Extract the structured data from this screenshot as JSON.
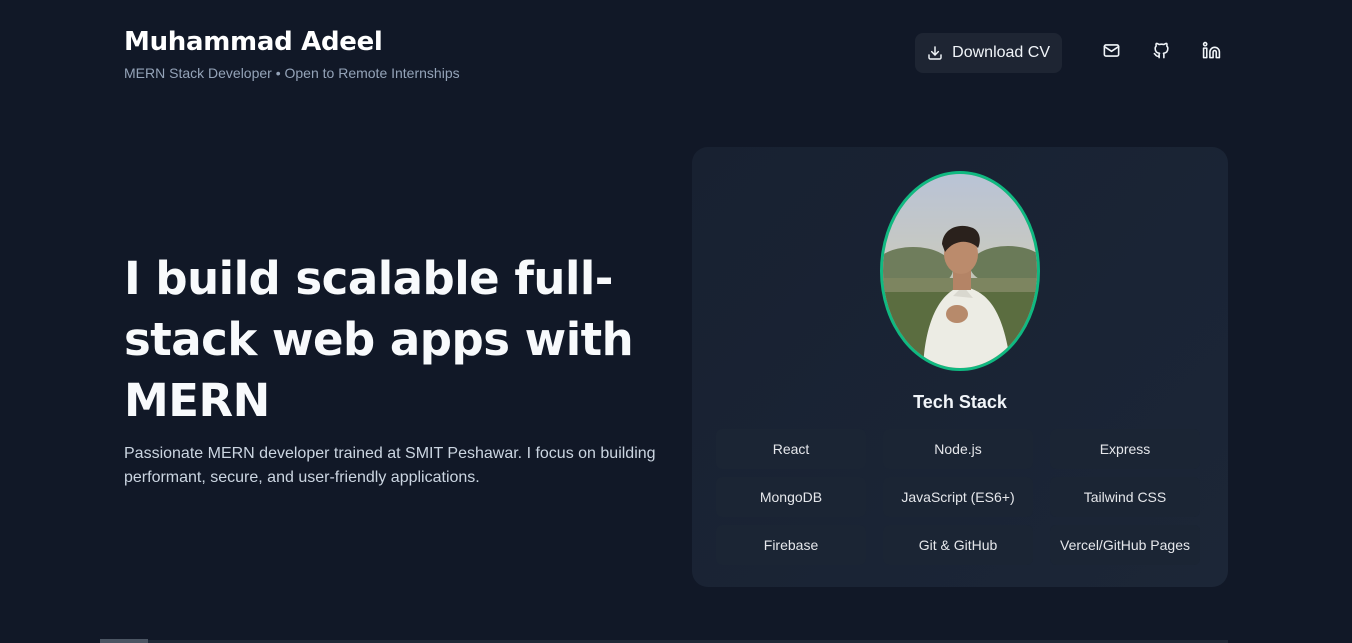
{
  "header": {
    "name": "Muhammad Adeel",
    "subtitle": "MERN Stack Developer • Open to Remote Internships",
    "download_cv_label": "Download CV",
    "icons": [
      "download-icon",
      "mail-icon",
      "github-icon",
      "linkedin-icon"
    ]
  },
  "hero": {
    "title": "I build scalable full-stack web apps with MERN",
    "description": "Passionate MERN developer trained at SMIT Peshawar. I focus on building performant, secure, and user-friendly applications."
  },
  "card": {
    "stack_title": "Tech Stack",
    "stack": [
      "React",
      "Node.js",
      "Express",
      "MongoDB",
      "JavaScript (ES6+)",
      "Tailwind CSS",
      "Firebase",
      "Git & GitHub",
      "Vercel/GitHub Pages"
    ]
  },
  "colors": {
    "background": "#111827",
    "card": "#1a2435",
    "accent": "#10b981",
    "muted_text": "#94a3b8"
  }
}
